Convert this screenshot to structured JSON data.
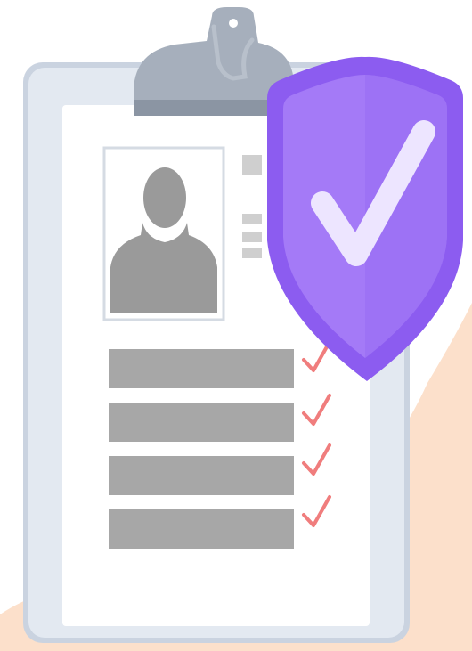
{
  "illustration": {
    "icons": {
      "background": "peach-background",
      "clipboard": "clipboard-icon",
      "profile": "profile-silhouette-icon",
      "check": "check-mark-icon",
      "shield": "shield-check-icon"
    },
    "checklist_items": 4,
    "colors": {
      "background_blob": "#FCE0CB",
      "clipboard_back": "#E3E9F1",
      "clipboard_border": "#CAD3E0",
      "paper": "#FFFFFF",
      "placeholder_bar": "#A7A7A7",
      "silhouette": "#9A9A9A",
      "clip_metal": "#A6AFBC",
      "clip_shadow": "#8B95A3",
      "check_mark": "#F07D7D",
      "shield_outer": "#8C5CF0",
      "shield_inner": "#A47AF7",
      "shield_tick": "#EDE5FF"
    }
  }
}
